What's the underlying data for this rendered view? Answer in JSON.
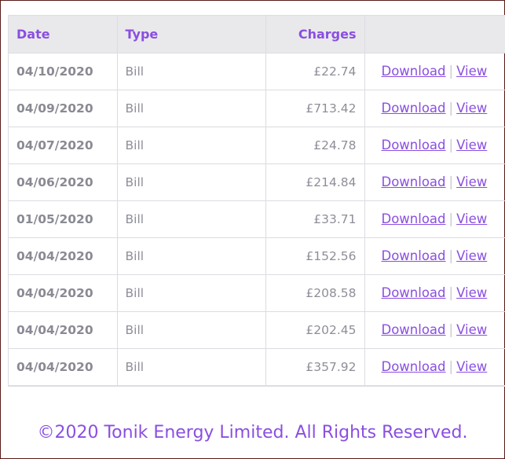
{
  "table": {
    "headers": {
      "date": "Date",
      "type": "Type",
      "charges": "Charges"
    },
    "download_label": "Download",
    "separator": "|",
    "view_label": "View",
    "rows": [
      {
        "date": "04/10/2020",
        "type": "Bill",
        "charges": "£22.74"
      },
      {
        "date": "04/09/2020",
        "type": "Bill",
        "charges": "£713.42"
      },
      {
        "date": "04/07/2020",
        "type": "Bill",
        "charges": "£24.78"
      },
      {
        "date": "04/06/2020",
        "type": "Bill",
        "charges": "£214.84"
      },
      {
        "date": "01/05/2020",
        "type": "Bill",
        "charges": "£33.71"
      },
      {
        "date": "04/04/2020",
        "type": "Bill",
        "charges": "£152.56"
      },
      {
        "date": "04/04/2020",
        "type": "Bill",
        "charges": "£208.58"
      },
      {
        "date": "04/04/2020",
        "type": "Bill",
        "charges": "£202.45"
      },
      {
        "date": "04/04/2020",
        "type": "Bill",
        "charges": "£357.92"
      }
    ]
  },
  "footer": {
    "copyright": "©2020 Tonik Energy Limited. All Rights Reserved."
  },
  "colors": {
    "accent": "#8a4fe0",
    "text_muted": "#8e8e98",
    "header_bg": "#e9e9ec",
    "border": "#dcdce2"
  }
}
